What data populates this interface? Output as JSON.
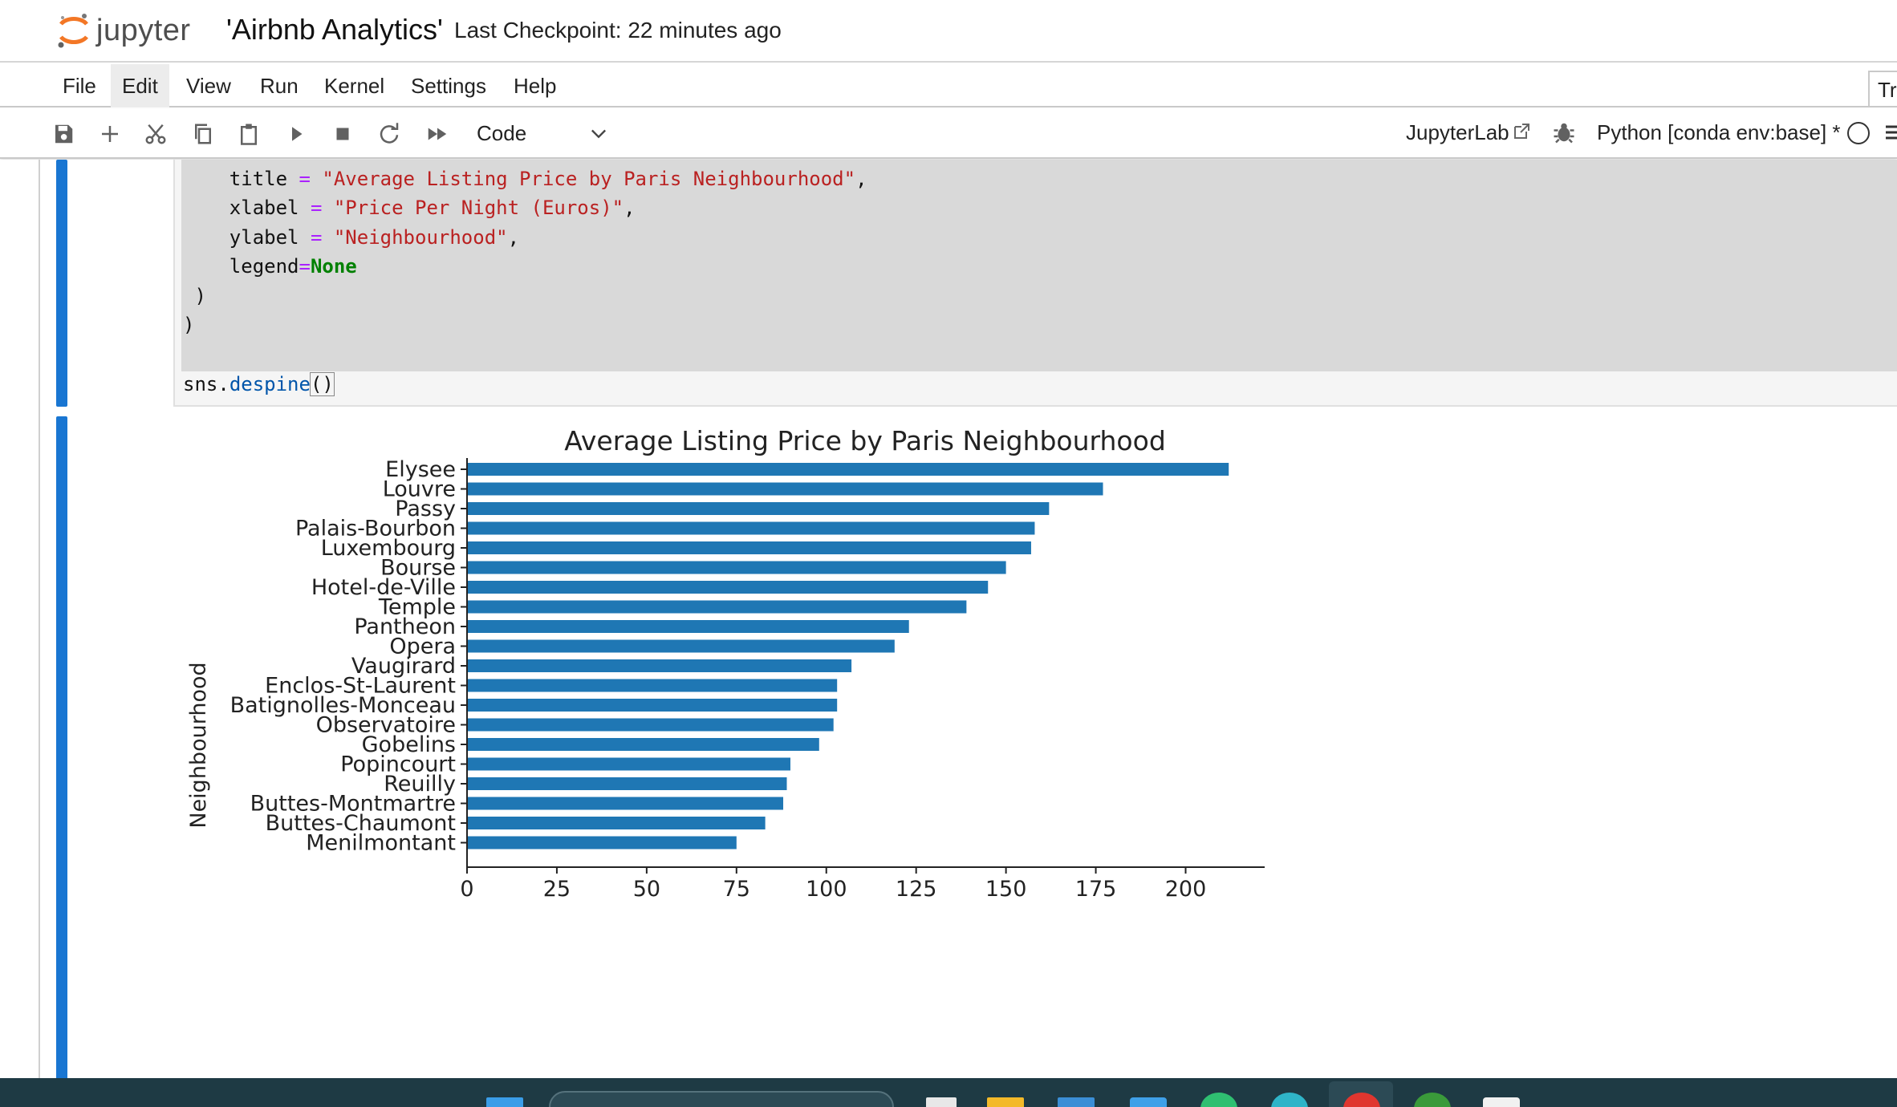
{
  "header": {
    "logo_text": "jupyter",
    "notebook_title": "'Airbnb Analytics'",
    "checkpoint": "Last Checkpoint: 22 minutes ago"
  },
  "menu": {
    "items": [
      "File",
      "Edit",
      "View",
      "Run",
      "Kernel",
      "Settings",
      "Help"
    ],
    "active": "Edit",
    "partial_tab": "Tr"
  },
  "toolbar": {
    "cell_type": "Code",
    "jupyterlab_link": "JupyterLab",
    "kernel": "Python [conda env:base] *",
    "icons": [
      "save-icon",
      "add-cell-icon",
      "cut-icon",
      "copy-icon",
      "paste-icon",
      "run-icon",
      "stop-icon",
      "restart-icon",
      "fast-forward-icon"
    ]
  },
  "code": {
    "line1_var": "title",
    "line1_val": "\"Average Listing Price by Paris Neighbourhood\"",
    "line2_var": "xlabel",
    "line2_val": "\"Price Per Night (Euros)\"",
    "line3_var": "ylabel",
    "line3_val": "\"Neighbourhood\"",
    "line4_var": "legend",
    "line4_val": "None",
    "line5": " )",
    "line6": ")",
    "line7_obj": "sns",
    "line7_fn": "despine"
  },
  "chart_data": {
    "type": "bar",
    "orientation": "horizontal",
    "title": "Average Listing Price by Paris Neighbourhood",
    "xlabel": "",
    "ylabel": "Neighbourhood",
    "categories": [
      "Elysee",
      "Louvre",
      "Passy",
      "Palais-Bourbon",
      "Luxembourg",
      "Bourse",
      "Hotel-de-Ville",
      "Temple",
      "Pantheon",
      "Opera",
      "Vaugirard",
      "Enclos-St-Laurent",
      "Batignolles-Monceau",
      "Observatoire",
      "Gobelins",
      "Popincourt",
      "Reuilly",
      "Buttes-Montmartre",
      "Buttes-Chaumont",
      "Menilmontant"
    ],
    "values": [
      212,
      177,
      162,
      158,
      157,
      150,
      145,
      139,
      123,
      119,
      107,
      103,
      103,
      102,
      98,
      90,
      89,
      88,
      83,
      75
    ],
    "xticks": [
      0,
      25,
      50,
      75,
      100,
      125,
      150,
      175,
      200
    ],
    "xlim": [
      0,
      222
    ],
    "bar_color": "#1f77b4",
    "legend": "none"
  },
  "colors": {
    "accent": "#1976d2",
    "logo_orange": "#f37726",
    "taskbar": "#1e3a44"
  }
}
